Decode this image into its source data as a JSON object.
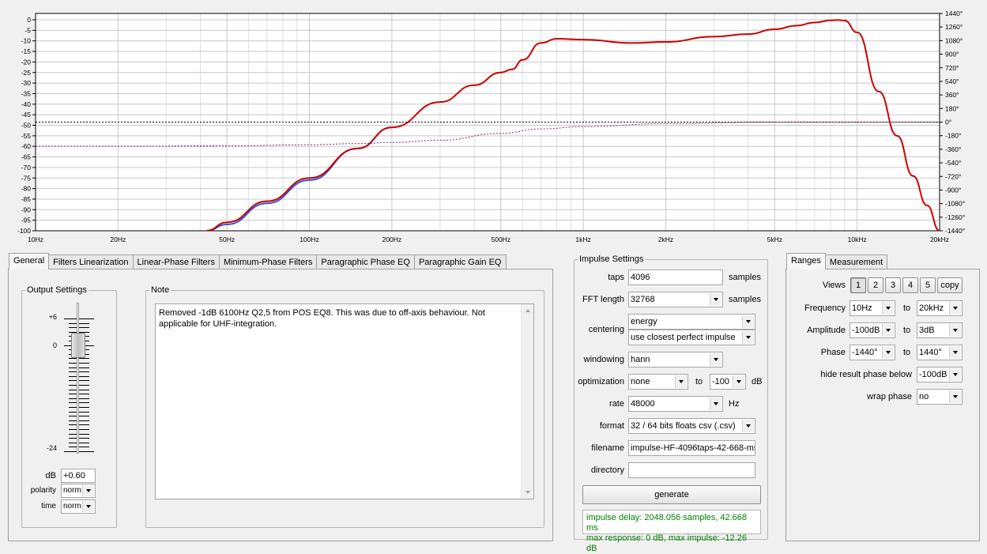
{
  "chart": {
    "left_axis_labels": [
      "0",
      "-5",
      "-10",
      "-15",
      "-20",
      "-25",
      "-30",
      "-35",
      "-40",
      "-45",
      "-50",
      "-55",
      "-60",
      "-65",
      "-70",
      "-75",
      "-80",
      "-85",
      "-90",
      "-95",
      "-100"
    ],
    "right_axis_labels": [
      "1440°",
      "1260°",
      "1080°",
      "900°",
      "720°",
      "540°",
      "360°",
      "180°",
      "0°",
      "-180°",
      "-360°",
      "-540°",
      "-720°",
      "-900°",
      "-1080°",
      "-1260°",
      "-1440°"
    ],
    "freq_labels": [
      "10Hz",
      "20Hz",
      "50Hz",
      "100Hz",
      "200Hz",
      "500Hz",
      "1kHz",
      "2kHz",
      "5kHz",
      "10kHz",
      "20kHz"
    ],
    "colors": {
      "magnitude": "#cc0000",
      "original": "#2b55e0",
      "phase": "#7a2a70",
      "grid_major": "#c8c8c8",
      "grid_minor": "#e0e0e0",
      "plot_bg": "#ffffff"
    }
  },
  "chart_data": {
    "type": "line",
    "x_scale": "log",
    "xlim": [
      10,
      20000
    ],
    "ylim": [
      -100,
      3
    ],
    "y2lim": [
      -1440,
      1440
    ],
    "xlabel": "",
    "ylabel": "",
    "grid": true,
    "series": [
      {
        "axis": "amplitude_dB",
        "x": [
          42,
          50,
          70,
          100,
          150,
          200,
          300,
          400,
          500,
          550,
          600,
          700,
          800,
          1000,
          1500,
          2000,
          3000,
          4000,
          5000,
          6000,
          7000,
          8000,
          8500,
          9000,
          10000,
          12000,
          14000,
          16000,
          18000,
          20000
        ],
        "y": [
          -100,
          -96,
          -86,
          -75,
          -61,
          -51,
          -39,
          -31,
          -25,
          -23.5,
          -19,
          -11,
          -9,
          -9.4,
          -11,
          -10.5,
          -8,
          -6.8,
          -4.5,
          -2.8,
          -1.3,
          -0.3,
          -0.1,
          -0.4,
          -6,
          -34,
          -55,
          -74,
          -88,
          -100
        ]
      },
      {
        "axis": "amplitude_dB",
        "x": [
          42,
          50,
          70,
          100,
          150,
          200
        ],
        "y": [
          -100,
          -97,
          -87,
          -76,
          -61,
          -51
        ]
      },
      {
        "axis": "phase_deg",
        "x": [
          10,
          20,
          50,
          100,
          150,
          200,
          300,
          500,
          700,
          1000,
          2000,
          5000,
          8000,
          10000,
          20000
        ],
        "y": [
          -320,
          -320,
          -315,
          -300,
          -285,
          -270,
          -240,
          -150,
          -90,
          -60,
          -20,
          0,
          0,
          0,
          0
        ]
      },
      {
        "axis": "phase_deg",
        "name": "0° reference",
        "x": [
          10,
          20000
        ],
        "y": [
          0,
          0
        ]
      }
    ]
  },
  "tabs": [
    "General",
    "Filters Linearization",
    "Linear-Phase Filters",
    "Minimum-Phase Filters",
    "Paragraphic Phase EQ",
    "Paragraphic Gain EQ"
  ],
  "output_settings": {
    "title": "Output Settings",
    "scale_top": "+6",
    "scale_zero": "0",
    "scale_bottom": "-24",
    "gain_fraction": 0.2,
    "db_label": "dB",
    "db_value": "+0.60",
    "polarity_label": "polarity",
    "polarity_value": "norm",
    "time_label": "time",
    "time_value": "norm"
  },
  "note": {
    "title": "Note",
    "text": "Removed -1dB 6100Hz Q2,5 from POS EQ8. This was due to off-axis behaviour. Not applicable for UHF-integration."
  },
  "impulse": {
    "title": "Impulse Settings",
    "taps_label": "taps",
    "taps_value": "4096",
    "taps_unit": "samples",
    "fft_label": "FFT length",
    "fft_value": "32768",
    "fft_unit": "samples",
    "centering_label": "centering",
    "centering_value": "energy",
    "centering_value2": "use closest perfect impulse",
    "windowing_label": "windowing",
    "windowing_value": "hann",
    "optimization_label": "optimization",
    "optimization_value": "none",
    "optimization_to": "to",
    "optimization_limit": "-100",
    "optimization_unit": "dB",
    "rate_label": "rate",
    "rate_value": "48000",
    "rate_unit": "Hz",
    "format_label": "format",
    "format_value": "32 / 64 bits floats csv (.csv)",
    "filename_label": "filename",
    "filename_value": "impulse-HF-4096taps-42-668-ms",
    "directory_label": "directory",
    "directory_value": "",
    "generate_label": "generate",
    "status_line1": "impulse delay: 2048.056 samples, 42.668 ms",
    "status_line2": "max response: 0 dB, max impulse: -12.26 dB"
  },
  "ranges": {
    "tabs": [
      "Ranges",
      "Measurement"
    ],
    "views_label": "Views",
    "views": [
      "1",
      "2",
      "3",
      "4",
      "5"
    ],
    "copy_label": "copy",
    "frequency_label": "Frequency",
    "frequency_from": "10Hz",
    "frequency_to_label": "to",
    "frequency_to": "20kHz",
    "amplitude_label": "Amplitude",
    "amplitude_from": "-100dB",
    "amplitude_to_label": "to",
    "amplitude_to": "3dB",
    "phase_label": "Phase",
    "phase_from": "-1440°",
    "phase_to_label": "to",
    "phase_to": "1440°",
    "hide_label": "hide result phase below",
    "hide_value": "-100dB",
    "wrap_label": "wrap phase",
    "wrap_value": "no"
  }
}
